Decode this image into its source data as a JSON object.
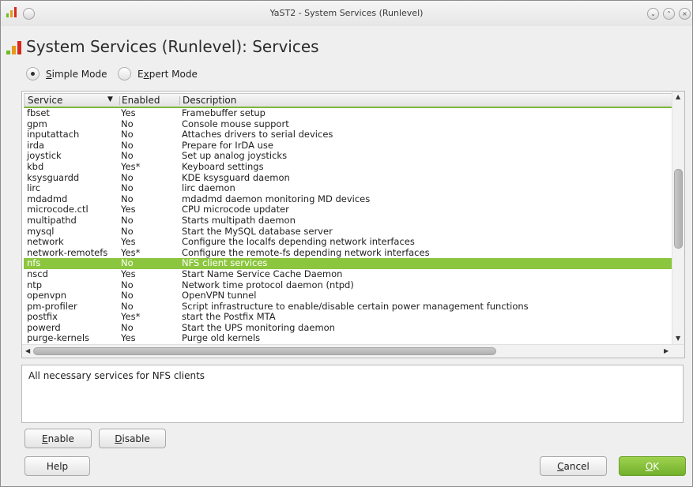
{
  "window": {
    "title": "YaST2 - System Services (Runlevel)"
  },
  "heading": "System Services (Runlevel): Services",
  "modes": {
    "simple": {
      "mnemonic": "S",
      "rest": "imple Mode",
      "selected": true
    },
    "expert": {
      "pre": "E",
      "mnemonic": "x",
      "rest": "pert Mode",
      "selected": false
    }
  },
  "table": {
    "columns": [
      "Service",
      "Enabled",
      "Description"
    ],
    "sort_column": "Service",
    "selected_row": "nfs",
    "rows": [
      {
        "service": "fbset",
        "enabled": "Yes",
        "description": "Framebuffer setup"
      },
      {
        "service": "gpm",
        "enabled": "No",
        "description": "Console mouse support"
      },
      {
        "service": "inputattach",
        "enabled": "No",
        "description": "Attaches drivers to serial devices"
      },
      {
        "service": "irda",
        "enabled": "No",
        "description": "Prepare for IrDA use"
      },
      {
        "service": "joystick",
        "enabled": "No",
        "description": "Set up analog joysticks"
      },
      {
        "service": "kbd",
        "enabled": "Yes*",
        "description": "Keyboard settings"
      },
      {
        "service": "ksysguardd",
        "enabled": "No",
        "description": "KDE ksysguard daemon"
      },
      {
        "service": "lirc",
        "enabled": "No",
        "description": "lirc daemon"
      },
      {
        "service": "mdadmd",
        "enabled": "No",
        "description": "mdadmd daemon monitoring MD devices"
      },
      {
        "service": "microcode.ctl",
        "enabled": "Yes",
        "description": "CPU microcode updater"
      },
      {
        "service": "multipathd",
        "enabled": "No",
        "description": "Starts multipath daemon"
      },
      {
        "service": "mysql",
        "enabled": "No",
        "description": "Start the MySQL database server"
      },
      {
        "service": "network",
        "enabled": "Yes",
        "description": "Configure the localfs depending network interfaces"
      },
      {
        "service": "network-remotefs",
        "enabled": "Yes*",
        "description": "Configure the remote-fs depending network interfaces"
      },
      {
        "service": "nfs",
        "enabled": "No",
        "description": "NFS client services"
      },
      {
        "service": "nscd",
        "enabled": "Yes",
        "description": "Start Name Service Cache Daemon"
      },
      {
        "service": "ntp",
        "enabled": "No",
        "description": "Network time protocol daemon (ntpd)"
      },
      {
        "service": "openvpn",
        "enabled": "No",
        "description": "OpenVPN tunnel"
      },
      {
        "service": "pm-profiler",
        "enabled": "No",
        "description": "Script infrastructure to enable/disable certain power management functions"
      },
      {
        "service": "postfix",
        "enabled": "Yes*",
        "description": "start the Postfix MTA"
      },
      {
        "service": "powerd",
        "enabled": "No",
        "description": "Start the UPS monitoring daemon"
      },
      {
        "service": "purge-kernels",
        "enabled": "Yes",
        "description": "Purge old kernels"
      }
    ]
  },
  "description_text": "All necessary services for NFS clients",
  "buttons": {
    "enable": {
      "mnemonic": "E",
      "rest": "nable"
    },
    "disable": {
      "mnemonic": "D",
      "rest": "isable"
    },
    "help": "Help",
    "cancel": {
      "mnemonic": "C",
      "rest": "ancel"
    },
    "ok": {
      "mnemonic": "O",
      "rest": "K"
    }
  },
  "colors": {
    "accent_green": "#8cc63e",
    "ok_button": "#7ab833",
    "header_underline": "#7fb63a"
  },
  "icons": {
    "app": "yast-signal-bars-icon",
    "sort": "chevron-down-icon"
  }
}
